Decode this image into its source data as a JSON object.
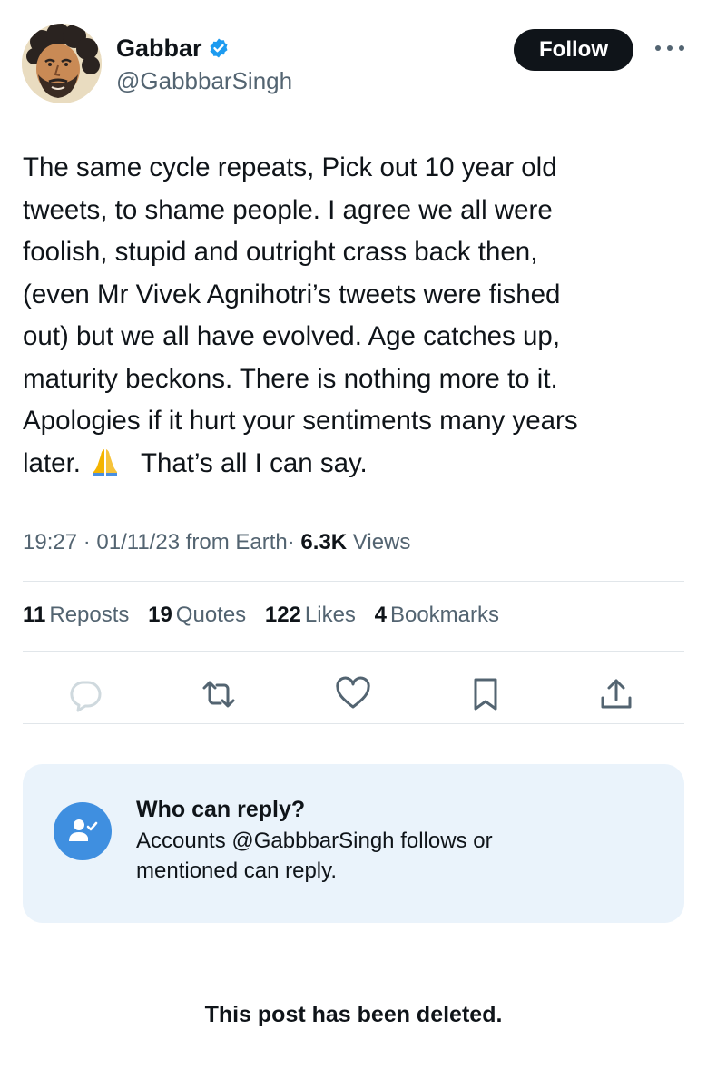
{
  "author": {
    "display_name": "Gabbar",
    "handle": "@GabbbarSingh",
    "verified": true,
    "avatar_icon": "cartoon-avatar"
  },
  "header": {
    "follow_label": "Follow",
    "more_icon": "more-horizontal-icon"
  },
  "tweet": {
    "lines": [
      "The same cycle repeats, Pick out 10 year old",
      "tweets, to shame people. I agree we all were",
      "foolish, stupid and outright crass back then,",
      "(even Mr Vivek Agnihotri’s tweets were fished",
      "out) but we all have evolved. Age catches up,",
      "maturity beckons. There is nothing more to it.",
      "Apologies if it hurt your sentiments many years"
    ],
    "last_line_start": "later.",
    "emoji": "folded-hands-emoji",
    "last_line_end": "That’s all I can say."
  },
  "meta": {
    "time": "19:27",
    "date": "01/11/23",
    "source": "from Earth",
    "sep": "·",
    "views_count": "6.3K",
    "views_label": "Views"
  },
  "stats": [
    {
      "count": "11",
      "label": "Reposts"
    },
    {
      "count": "19",
      "label": "Quotes"
    },
    {
      "count": "122",
      "label": "Likes"
    },
    {
      "count": "4",
      "label": "Bookmarks"
    }
  ],
  "actions": [
    "reply-icon",
    "repost-icon",
    "like-icon",
    "bookmark-icon",
    "share-icon"
  ],
  "reply_settings": {
    "title": "Who can reply?",
    "line1": "Accounts @GabbbarSingh follows or",
    "line2": "mentioned can reply."
  },
  "deleted_notice": "This post has been deleted.",
  "colors": {
    "text": "#0f1419",
    "secondary": "#536471",
    "verified_blue": "#1d9bf0",
    "reply_box_bg": "#eaf3fb",
    "reply_icon_bg": "#3f8fe0",
    "follow_bg": "#0f1419"
  }
}
